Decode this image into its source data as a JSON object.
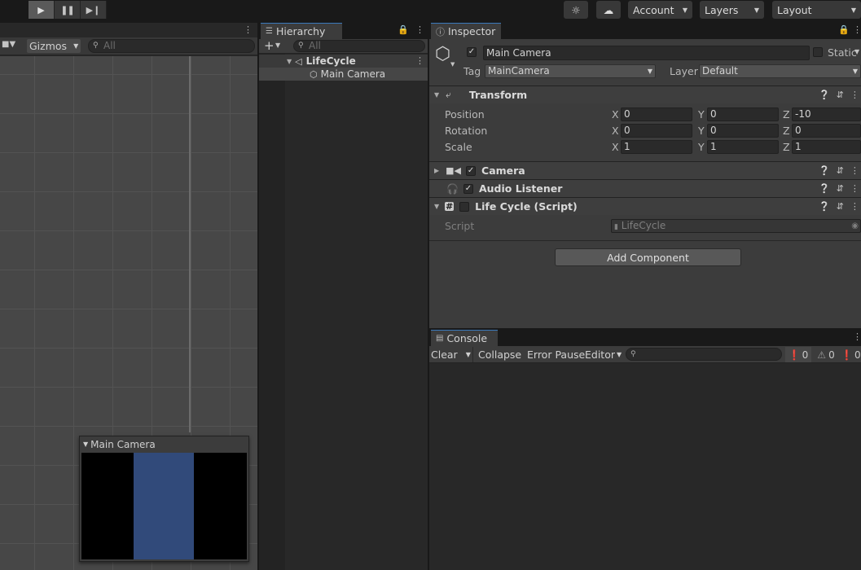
{
  "toolbar": {
    "play_icon": "play-icon",
    "pause_icon": "pause-icon",
    "step_icon": "step-icon",
    "account": "Account",
    "layers": "Layers",
    "layout": "Layout"
  },
  "scene": {
    "gizmos": "Gizmos",
    "search_placeholder": "All",
    "camera_preview_title": "Main Camera",
    "preview_bg": "#000000",
    "preview_fg": "#314a7a"
  },
  "hierarchy": {
    "tab": "Hierarchy",
    "search_placeholder": "All",
    "root": "LifeCycle",
    "child": "Main Camera"
  },
  "inspector": {
    "tab": "Inspector",
    "object_name": "Main Camera",
    "static_label": "Static",
    "tag_label": "Tag",
    "tag_value": "MainCamera",
    "layer_label": "Layer",
    "layer_value": "Default",
    "transform": {
      "title": "Transform",
      "position_label": "Position",
      "rotation_label": "Rotation",
      "scale_label": "Scale",
      "position": {
        "x": "0",
        "y": "0",
        "z": "-10"
      },
      "rotation": {
        "x": "0",
        "y": "0",
        "z": "0"
      },
      "scale": {
        "x": "1",
        "y": "1",
        "z": "1"
      },
      "x": "X",
      "y": "Y",
      "z": "Z"
    },
    "camera": "Camera",
    "audio_listener": "Audio Listener",
    "script_component": "Life Cycle (Script)",
    "script_label": "Script",
    "script_value": "LifeCycle",
    "add_component": "Add Component"
  },
  "console": {
    "tab": "Console",
    "clear": "Clear",
    "collapse": "Collapse",
    "error_pause": "Error Pause",
    "editor": "Editor",
    "log_count": "0",
    "warn_count": "0",
    "error_count": "0"
  },
  "colors": {
    "accent": "#3a79bb",
    "panel": "#282828",
    "header": "#3e3e3e"
  }
}
